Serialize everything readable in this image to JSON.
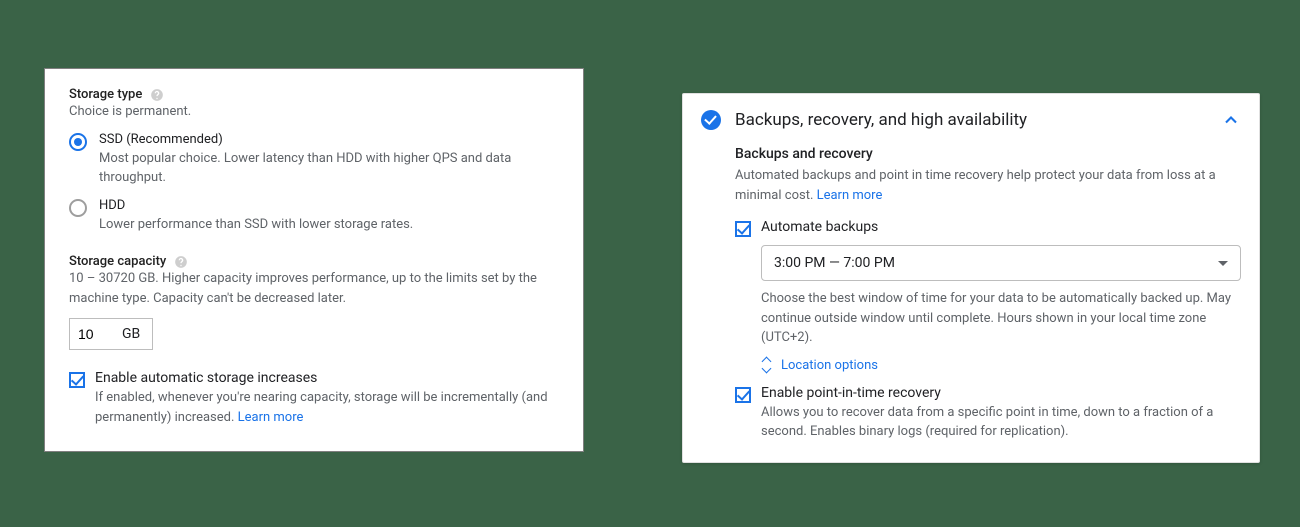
{
  "storage": {
    "type_label": "Storage type",
    "type_note": "Choice is permanent.",
    "options": [
      {
        "label": "SSD (Recommended)",
        "desc": "Most popular choice. Lower latency than HDD with higher QPS and data throughput."
      },
      {
        "label": "HDD",
        "desc": "Lower performance than SSD with lower storage rates."
      }
    ],
    "capacity_label": "Storage capacity",
    "capacity_note": "10 – 30720 GB. Higher capacity improves performance, up to the limits set by the machine type. Capacity can't be decreased later.",
    "capacity_value": "10",
    "capacity_unit": "GB",
    "auto_increase_label": "Enable automatic storage increases",
    "auto_increase_desc": "If enabled, whenever you're nearing capacity, storage will be incrementally (and permanently) increased. ",
    "learn_more": "Learn more"
  },
  "backups": {
    "header": "Backups, recovery, and high availability",
    "subheading": "Backups and recovery",
    "intro": "Automated backups and point in time recovery help protect your data from loss at a minimal cost. ",
    "learn_more": "Learn more",
    "automate_label": "Automate backups",
    "window_value": "3:00 PM — 7:00 PM",
    "window_help": "Choose the best window of time for your data to be automatically backed up. May continue outside window until complete. Hours shown in your local time zone (UTC+2).",
    "location_options": "Location options",
    "pitr_label": "Enable point-in-time recovery",
    "pitr_desc": "Allows you to recover data from a specific point in time, down to a fraction of a second. Enables binary logs (required for replication)."
  }
}
